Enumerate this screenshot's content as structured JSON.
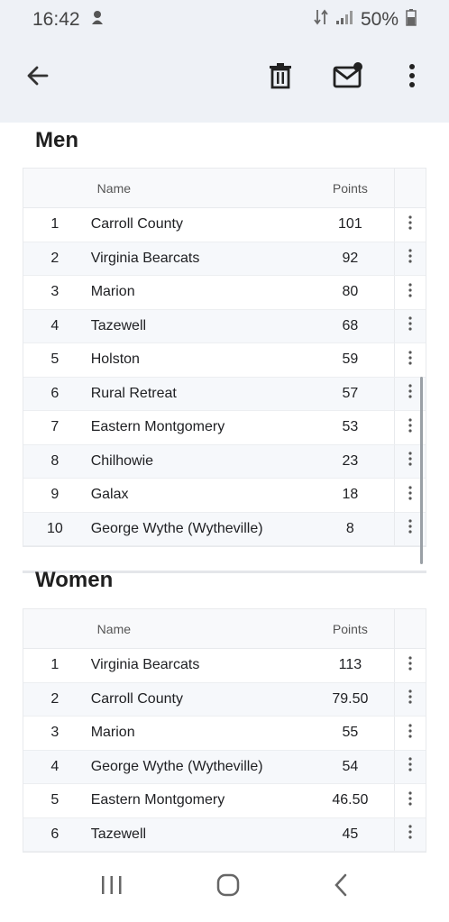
{
  "status": {
    "time": "16:42",
    "battery": "50%"
  },
  "icons": {
    "back": "arrow-left-icon",
    "delete": "trash-icon",
    "mark_unread": "mail-unread-icon",
    "more": "more-vert-icon"
  },
  "men": {
    "title": "Men",
    "headers": {
      "name": "Name",
      "points": "Points"
    },
    "rows": [
      {
        "rank": "1",
        "name": "Carroll County",
        "points": "101"
      },
      {
        "rank": "2",
        "name": "Virginia Bearcats",
        "points": "92"
      },
      {
        "rank": "3",
        "name": "Marion",
        "points": "80"
      },
      {
        "rank": "4",
        "name": "Tazewell",
        "points": "68"
      },
      {
        "rank": "5",
        "name": "Holston",
        "points": "59"
      },
      {
        "rank": "6",
        "name": "Rural Retreat",
        "points": "57"
      },
      {
        "rank": "7",
        "name": "Eastern Montgomery",
        "points": "53"
      },
      {
        "rank": "8",
        "name": "Chilhowie",
        "points": "23"
      },
      {
        "rank": "9",
        "name": "Galax",
        "points": "18"
      },
      {
        "rank": "10",
        "name": "George Wythe (Wytheville)",
        "points": "8"
      }
    ]
  },
  "women": {
    "title": "Women",
    "headers": {
      "name": "Name",
      "points": "Points"
    },
    "rows": [
      {
        "rank": "1",
        "name": "Virginia Bearcats",
        "points": "113"
      },
      {
        "rank": "2",
        "name": "Carroll County",
        "points": "79.50"
      },
      {
        "rank": "3",
        "name": "Marion",
        "points": "55"
      },
      {
        "rank": "4",
        "name": "George Wythe (Wytheville)",
        "points": "54"
      },
      {
        "rank": "5",
        "name": "Eastern Montgomery",
        "points": "46.50"
      },
      {
        "rank": "6",
        "name": "Tazewell",
        "points": "45"
      }
    ]
  }
}
